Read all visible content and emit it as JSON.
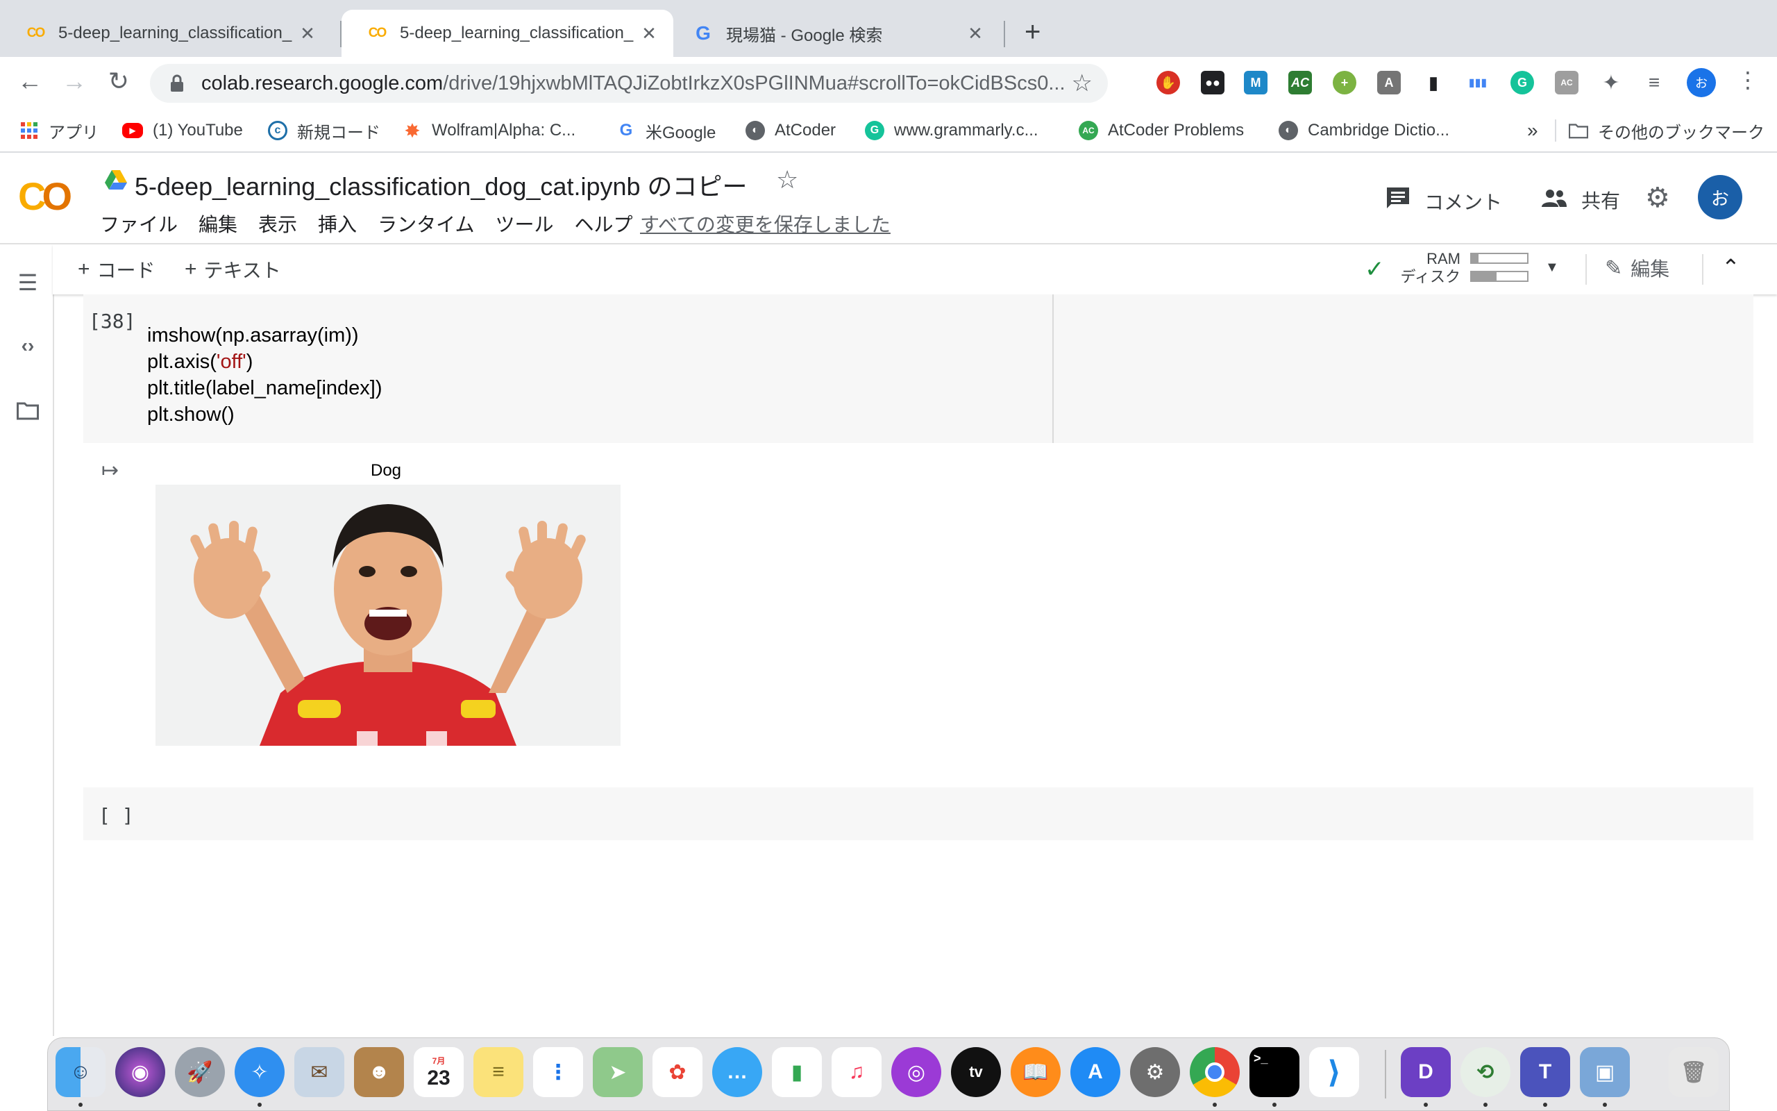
{
  "browser": {
    "tabs": [
      {
        "title": "5-deep_learning_classification_",
        "favicon": "colab-logo",
        "active": false
      },
      {
        "title": "5-deep_learning_classification_",
        "favicon": "colab-logo",
        "active": true
      },
      {
        "title": "現場猫 - Google 検索",
        "favicon": "google-logo",
        "active": false
      }
    ],
    "url_host": "colab.research.google.com",
    "url_path": "/drive/19hjxwbMlTAQJiZobtIrkzX0sPGlINMua#scrollTo=okCidBScs0...",
    "profile_initial": "お",
    "bookmarks": [
      {
        "label": "アプリ",
        "icon": "apps-grid-icon"
      },
      {
        "label": "(1) YouTube",
        "icon": "youtube-icon"
      },
      {
        "label": "新規コード",
        "icon": "codeforces-icon"
      },
      {
        "label": "Wolfram|Alpha: C...",
        "icon": "wolfram-icon"
      },
      {
        "label": "米Google",
        "icon": "google-icon"
      },
      {
        "label": "AtCoder",
        "icon": "globe-icon"
      },
      {
        "label": "www.grammarly.c...",
        "icon": "grammarly-icon"
      },
      {
        "label": "AtCoder Problems",
        "icon": "atcoder-problems-icon"
      },
      {
        "label": "Cambridge Dictio...",
        "icon": "globe-icon"
      }
    ],
    "bookmarks_overflow": "»",
    "other_bookmarks": "その他のブックマーク"
  },
  "colab": {
    "logo_text": "CO",
    "notebook_title": "5-deep_learning_classification_dog_cat.ipynb のコピー",
    "menu": [
      "ファイル",
      "編集",
      "表示",
      "挿入",
      "ランタイム",
      "ツール",
      "ヘルプ"
    ],
    "saved_status": "すべての変更を保存しました",
    "comment_label": "コメント",
    "share_label": "共有",
    "user_initial": "お",
    "toolbar": {
      "add_code": "コード",
      "add_text": "テキスト",
      "ram_label": "RAM",
      "disk_label": "ディスク",
      "ram_usage": 0.12,
      "disk_usage": 0.45,
      "edit_label": "編集"
    },
    "cell": {
      "execution_count": "[38]",
      "code_lines": [
        {
          "pre": "imshow(np.asarray(im))",
          "str": "",
          "post": ""
        },
        {
          "pre": "plt.axis(",
          "str": "'off'",
          "post": ")"
        },
        {
          "pre": "plt.title(label_name[index])",
          "str": "",
          "post": ""
        },
        {
          "pre": "plt.show()",
          "str": "",
          "post": ""
        }
      ],
      "output_title": "Dog"
    },
    "empty_cell_count": "[ ]"
  },
  "colors": {
    "colab_orange": "#f9ab00",
    "code_cell_bg": "#f7f7f7",
    "string_red": "#a31515",
    "connected_green": "#1e8e3e"
  },
  "dock": {
    "apps": [
      "Finder",
      "Siri",
      "Launchpad",
      "Safari",
      "Mail",
      "Contacts",
      "Calendar",
      "Notes",
      "Reminders",
      "Maps",
      "Photos",
      "Messages",
      "Numbers",
      "Music",
      "Podcasts",
      "TV",
      "Books",
      "App Store",
      "System Preferences",
      "Chrome",
      "Terminal",
      "VS Code",
      "Dictionary",
      "Network",
      "Teams",
      "Preview",
      "Trash"
    ],
    "calendar_month": "7月",
    "calendar_day": "23"
  }
}
